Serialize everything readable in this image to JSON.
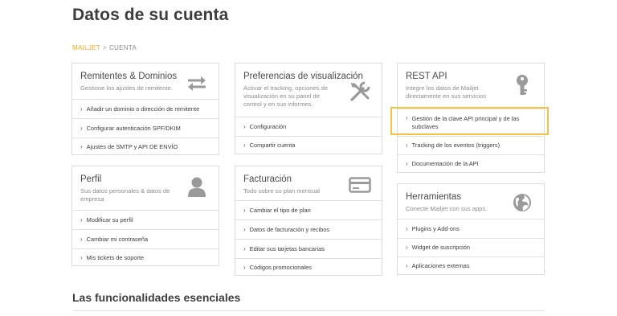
{
  "page": {
    "title": "Datos de su cuenta"
  },
  "breadcrumb": {
    "root": "MAILJET",
    "separator": ">",
    "current": "CUENTA"
  },
  "cards": {
    "remitentes": {
      "title": "Remitentes & Dominios",
      "desc": "Gestione los ajustes de remitente.",
      "icon": "arrows-swap-icon",
      "links": [
        "Añadir un dominio o dirección de remitente",
        "Configurar autenticación SPF/DKIM",
        "Ajustes de SMTP y API DE ENVÍO"
      ]
    },
    "perfil": {
      "title": "Perfil",
      "desc": "Sus datos personales & datos de empresa",
      "icon": "user-icon",
      "links": [
        "Modificar su perfil",
        "Cambiar mi contraseña",
        "Mis tickets de soporte"
      ]
    },
    "preferencias": {
      "title": "Preferencias de visualización",
      "desc": "Activar el tracking, opciones de visualización en su panel de control y en sus informes.",
      "icon": "tools-icon",
      "links": [
        "Configuración",
        "Compartir cuenta"
      ]
    },
    "facturacion": {
      "title": "Facturación",
      "desc": "Todo sobre su plan mensual",
      "icon": "credit-card-icon",
      "links": [
        "Cambiar el tipo de plan",
        "Datos de facturación y recibos",
        "Editar sus tarjetas bancarias",
        "Códigos promocionales"
      ]
    },
    "restapi": {
      "title": "REST API",
      "desc": "Integre los datos de Mailjet directamente en sus servicios",
      "icon": "key-icon",
      "links": [
        "Gestión de la clave API principal y de las subclaves",
        "Tracking de los eventos (triggers)",
        "Documentación de la API"
      ]
    },
    "herramientas": {
      "title": "Herramientas",
      "desc": "Conecte Mailjet con sus apps.",
      "icon": "globe-icon",
      "links": [
        "Plugins y Add-ons",
        "Widget de suscripción",
        "Aplicaciones externas"
      ]
    }
  },
  "sections": {
    "essentials": "Las funcionalidades esenciales"
  },
  "colors": {
    "accent": "#f1a91c",
    "highlight": "#f5c342",
    "border": "#dcdcdc",
    "icon": "#9a9a9a"
  }
}
